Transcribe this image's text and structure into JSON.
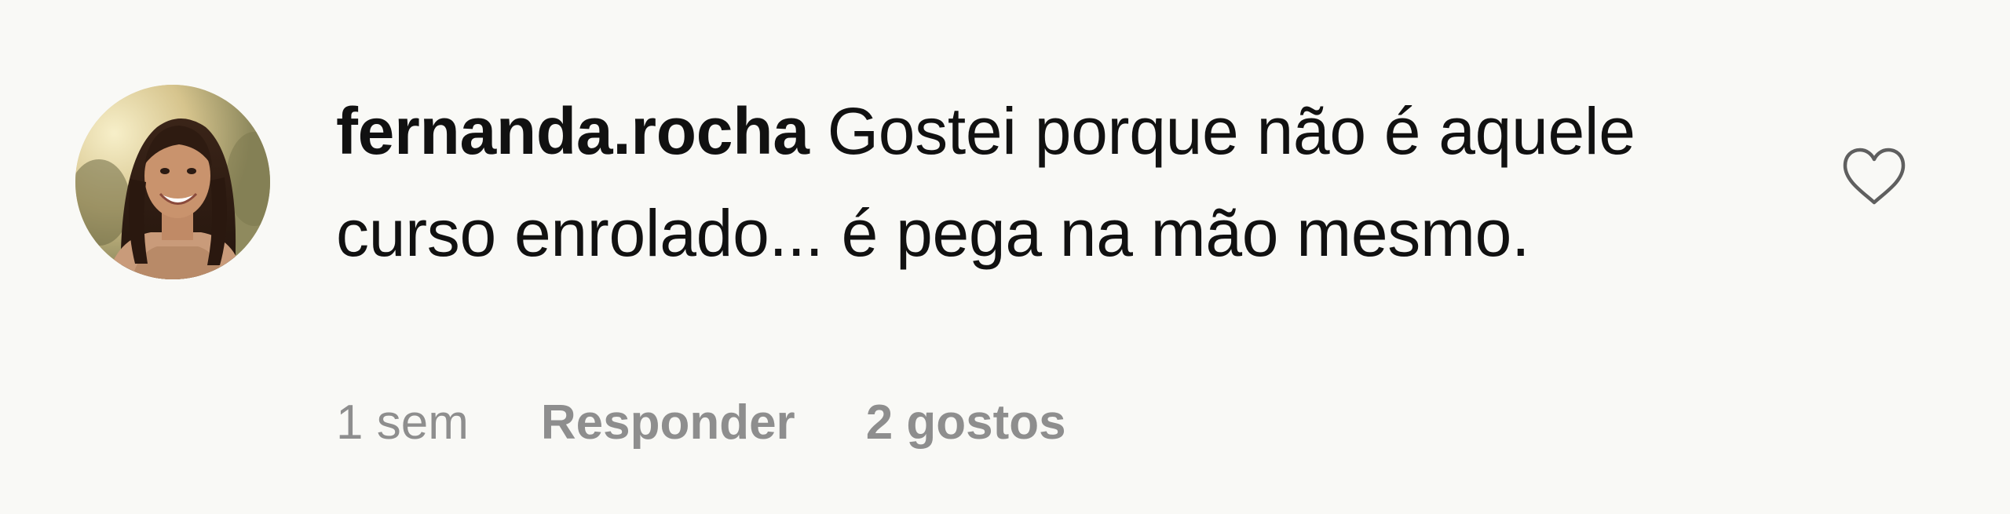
{
  "comment": {
    "username": "fernanda.rocha",
    "text": "Gostei porque não é aquele curso enrolado... é pega na mão mesmo.",
    "time_ago": "1 sem",
    "reply_label": "Responder",
    "likes_label": "2 gostos"
  },
  "icons": {
    "like": "heart-outline-icon",
    "avatar": "profile-photo"
  },
  "colors": {
    "background": "#f9f9f6",
    "text": "#111111",
    "meta": "#8e8e8e",
    "heart_stroke": "#5f5f5f"
  }
}
